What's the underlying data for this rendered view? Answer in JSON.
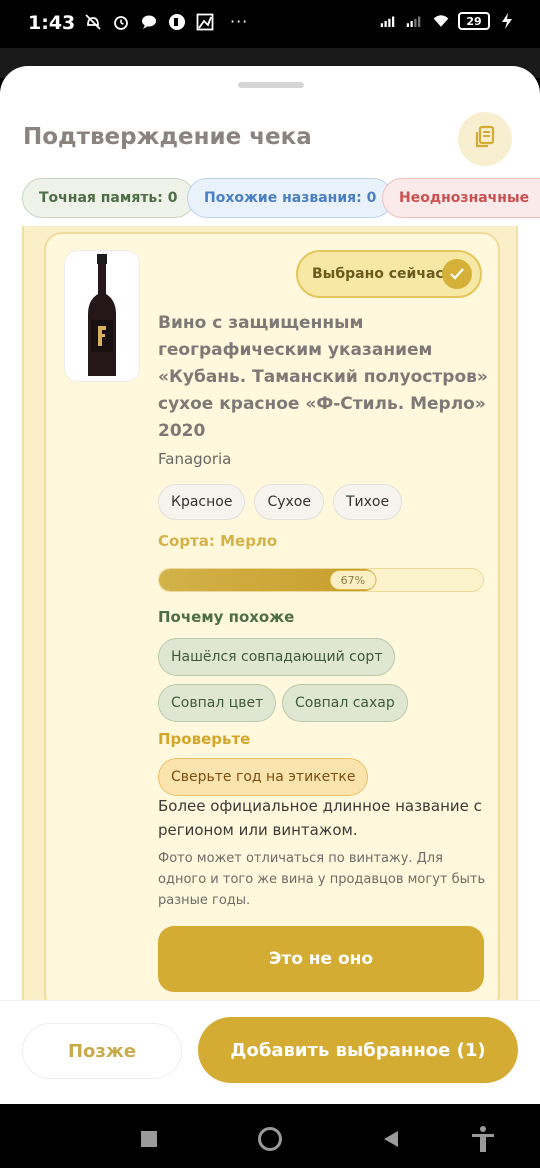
{
  "status_bar": {
    "time": "1:43",
    "dots": "···",
    "battery": "29"
  },
  "sheet": {
    "title": "Подтверждение чека",
    "filters": [
      {
        "label": "Точная память: 0"
      },
      {
        "label": "Похожие названия: 0"
      },
      {
        "label": "Неоднозначные"
      }
    ]
  },
  "card": {
    "selected_label": "Выбрано сейчас",
    "wine_name": "Вино с защищенным географическим указанием «Кубань. Таманский полуостров» сухое красное «Ф-Стиль. Мерло» 2020",
    "producer": "Fanagoria",
    "attributes": [
      "Красное",
      "Сухое",
      "Тихое"
    ],
    "grape": "Сорта: Мерло",
    "match_percent": 67,
    "match_label": "67%",
    "why_title": "Почему похоже",
    "why_tags": [
      "Нашёлся совпадающий сорт",
      "Совпал цвет",
      "Совпал сахар"
    ],
    "check_title": "Проверьте",
    "check_tags": [
      "Сверьте год на этикетке"
    ],
    "description": "Более официальное длинное название с регионом или винтажом.",
    "note": "Фото может отличаться по винтажу. Для одного и того же вина у продавцов могут быть разные годы.",
    "not_it_label": "Это не оно"
  },
  "bottom": {
    "later_label": "Позже",
    "add_label": "Добавить выбранное (1)"
  },
  "colors": {
    "accent": "#d4ac34",
    "card_bg": "#fff8dc",
    "green_text": "#4d6e48"
  }
}
